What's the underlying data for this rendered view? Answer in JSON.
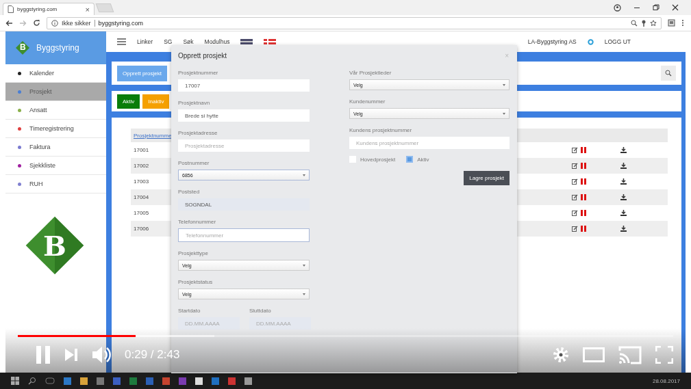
{
  "browser": {
    "tab_title": "byggstyring.com",
    "tab_close": "×",
    "security": "Ikke sikker",
    "url": "byggstyring.com"
  },
  "app": {
    "brand": "Byggstyring",
    "logo_letter": "B",
    "nav": [
      "Linker",
      "SG",
      "Søk",
      "Modulhus"
    ],
    "company": "LA-Byggstyring AS",
    "logout": "LOGG UT"
  },
  "sidebar": {
    "items": [
      {
        "label": "Kalender",
        "color": "#222222",
        "selected": false
      },
      {
        "label": "Prosjekt",
        "color": "#4a7fd4",
        "selected": true
      },
      {
        "label": "Ansatt",
        "color": "#8ab04a",
        "selected": false
      },
      {
        "label": "Timeregistrering",
        "color": "#e04040",
        "selected": false
      },
      {
        "label": "Faktura",
        "color": "#7a7ad0",
        "selected": false
      },
      {
        "label": "Sjekkliste",
        "color": "#a020a0",
        "selected": false
      },
      {
        "label": "RUH",
        "color": "#8080d0",
        "selected": false
      }
    ],
    "logo_letter": "B"
  },
  "main": {
    "create_button": "Opprett prosjekt",
    "filters": [
      {
        "label": "Aktiv",
        "color": "#0a7d0a"
      },
      {
        "label": "Inaktiv",
        "color": "#f5a000"
      }
    ]
  },
  "table": {
    "columns": [
      "Prosjektnumme"
    ],
    "rows": [
      "17001",
      "17002",
      "17003",
      "17004",
      "17005",
      "17006"
    ]
  },
  "modal": {
    "title": "Opprett prosjekt",
    "close": "×",
    "left_fields": [
      {
        "kind": "input",
        "label": "Prosjektnummer",
        "value": "17007",
        "focused": false
      },
      {
        "kind": "input",
        "label": "Prosjektnavn",
        "value": "Brede si hytte",
        "focused": false
      },
      {
        "kind": "input",
        "label": "Prosjektadresse",
        "placeholder": "Prosjektadresse",
        "focused": false
      },
      {
        "kind": "select",
        "label": "Postnummer",
        "value": "6856",
        "focused": true
      },
      {
        "kind": "readonly",
        "label": "Poststed",
        "value": "SOGNDAL",
        "focused": false
      },
      {
        "kind": "input",
        "label": "Telefonnummer",
        "placeholder": "Telefonnummer",
        "focused": true
      },
      {
        "kind": "select",
        "label": "Prosjekttype",
        "value": "Velg",
        "focused": false
      },
      {
        "kind": "select",
        "label": "Prosjektstatus",
        "value": "Velg",
        "focused": false
      }
    ],
    "date_fields": [
      {
        "label": "Startdato",
        "placeholder": "DD.MM.AAAA"
      },
      {
        "label": "Sluttdato",
        "placeholder": "DD.MM.AAAA"
      }
    ],
    "right_fields": [
      {
        "kind": "select",
        "label": "Vår Prosjektleder",
        "value": "Velg",
        "focused": false
      },
      {
        "kind": "select",
        "label": "Kundenummer",
        "value": "Velg",
        "focused": false
      },
      {
        "kind": "input",
        "label": "Kundens prosjektnummer",
        "placeholder": "Kundens prosjektnummer",
        "focused": false
      }
    ],
    "checkboxes": [
      {
        "label": "Hovedprosjekt",
        "checked": false
      },
      {
        "label": "Aktiv",
        "checked": true
      }
    ],
    "save_button": "Lagre prosjekt"
  },
  "video": {
    "level": 0.18,
    "time": "0:29 / 2:43"
  },
  "taskbar": {
    "date": "28.08.2017"
  }
}
